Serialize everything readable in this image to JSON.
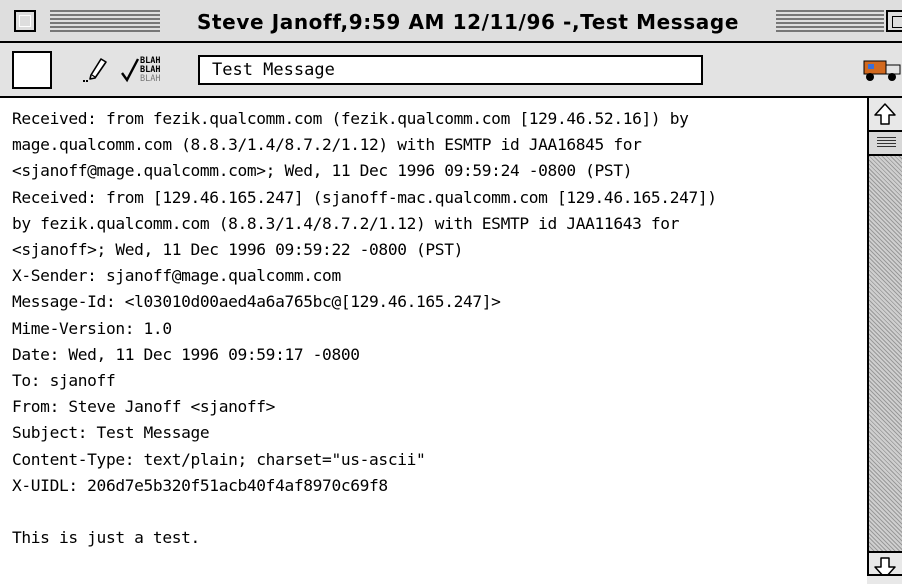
{
  "window": {
    "title": "Steve Janoff,9:59 AM 12/11/96 -,Test Message"
  },
  "toolbar": {
    "subject_value": "Test Message",
    "icons": [
      "priority-box",
      "pen-icon",
      "blah-icon",
      "truck-icon"
    ]
  },
  "message": {
    "body": "Received: from fezik.qualcomm.com (fezik.qualcomm.com [129.46.52.16]) by\nmage.qualcomm.com (8.8.3/1.4/8.7.2/1.12) with ESMTP id JAA16845 for\n<sjanoff@mage.qualcomm.com>; Wed, 11 Dec 1996 09:59:24 -0800 (PST)\nReceived: from [129.46.165.247] (sjanoff-mac.qualcomm.com [129.46.165.247])\nby fezik.qualcomm.com (8.8.3/1.4/8.7.2/1.12) with ESMTP id JAA11643 for\n<sjanoff>; Wed, 11 Dec 1996 09:59:22 -0800 (PST)\nX-Sender: sjanoff@mage.qualcomm.com\nMessage-Id: <l03010d00aed4a6a765bc@[129.46.165.247]>\nMime-Version: 1.0\nDate: Wed, 11 Dec 1996 09:59:17 -0800\nTo: sjanoff\nFrom: Steve Janoff <sjanoff>\nSubject: Test Message\nContent-Type: text/plain; charset=\"us-ascii\"\nX-UIDL: 206d7e5b320f51acb40f4af8970c69f8\n\nThis is just a test."
  }
}
